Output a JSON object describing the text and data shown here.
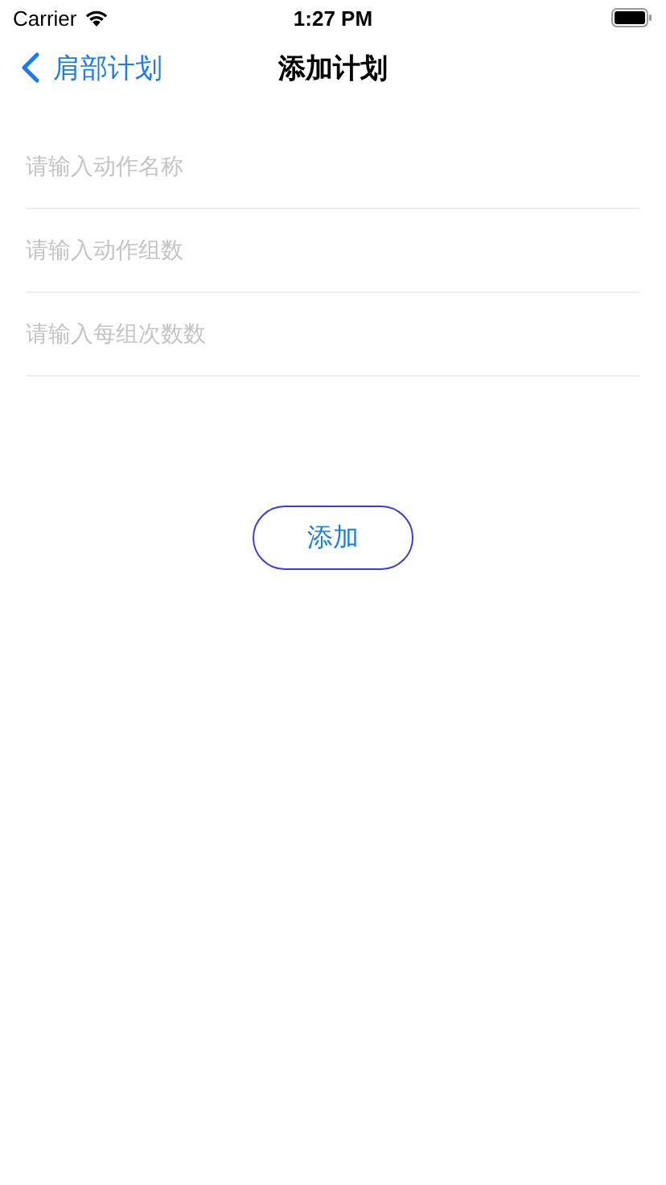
{
  "status_bar": {
    "carrier": "Carrier",
    "time": "1:27 PM"
  },
  "nav_bar": {
    "back_label": "肩部计划",
    "title": "添加计划"
  },
  "fields": [
    {
      "placeholder": "请输入动作名称"
    },
    {
      "placeholder": "请输入动作组数"
    },
    {
      "placeholder": "请输入每组次数数"
    }
  ],
  "add_button": "添加"
}
